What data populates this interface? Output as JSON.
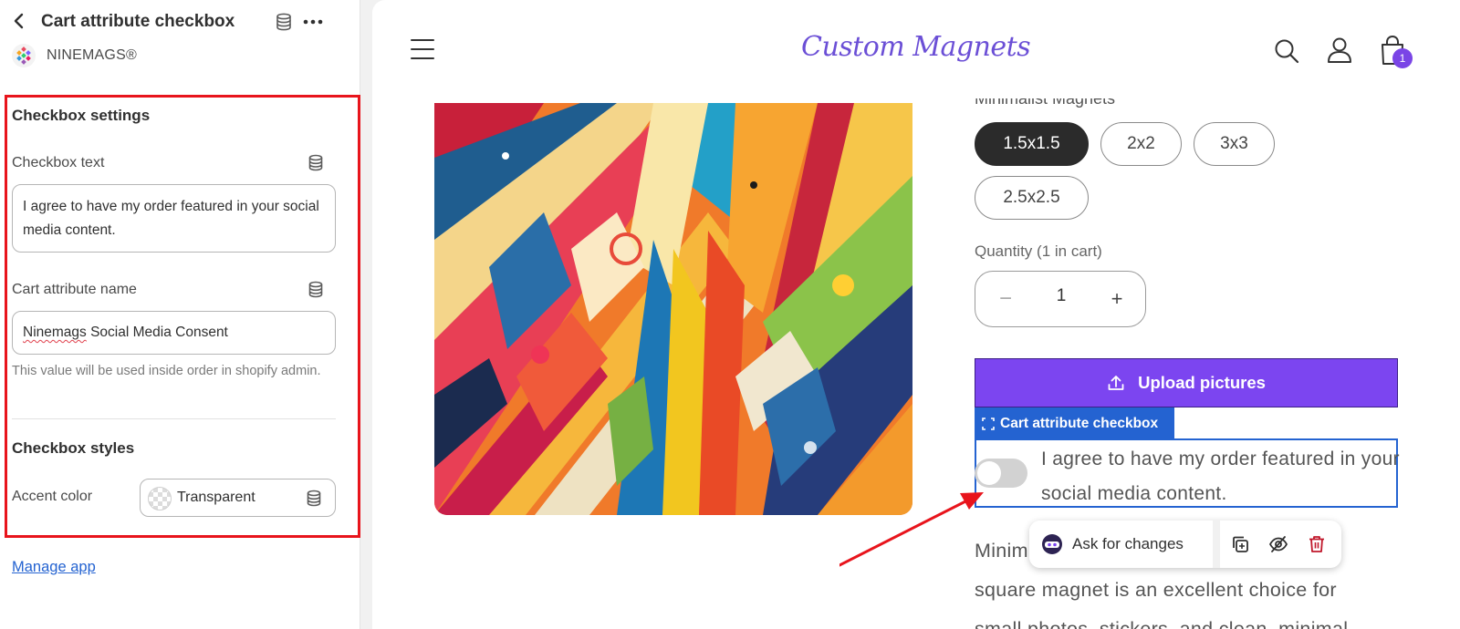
{
  "panel": {
    "title": "Cart attribute checkbox",
    "app_name": "NINEMAGS®",
    "section_checkbox_settings": "Checkbox settings",
    "checkbox_text_label": "Checkbox text",
    "checkbox_text_value": "I agree to have my order featured in your social media content.",
    "cart_attribute_label": "Cart attribute name",
    "cart_attribute_value_part1": "Ninemags",
    "cart_attribute_value_part2": " Social Media Consent",
    "help_text": "This value will be used inside order in shopify admin.",
    "section_checkbox_styles": "Checkbox styles",
    "accent_color_label": "Accent color",
    "accent_color_value": "Transparent",
    "manage_link": "Manage app"
  },
  "storefront": {
    "logo": "Custom Magnets",
    "cart_count": "1",
    "variant_label_cut": "Minimalist Magnets",
    "sizes": [
      "1.5x1.5",
      "2x2",
      "3x3",
      "2.5x2.5"
    ],
    "selected_size": "1.5x1.5",
    "quantity_label": "Quantity (1 in cart)",
    "quantity_value": "1",
    "minus": "−",
    "plus": "+",
    "upload_button": "Upload pictures",
    "block_tag": "Cart attribute checkbox",
    "checkbox_text": "I agree to have my order featured in your social media content.",
    "checkbox_checked": false,
    "ask_for_changes": "Ask for changes",
    "description_line1": "Minim",
    "description_line2": "square magnet is an excellent choice for",
    "description_line3": "small photos, stickers, and clean, minimal"
  },
  "colors": {
    "highlight_box": "#e8141c",
    "upload_button": "#7c45f0",
    "selection_blue": "#2463d1",
    "cart_badge": "#7a45e6",
    "logo": "#6b4fd6",
    "arrow": "#e8141c"
  },
  "icons": [
    "back-arrow-icon",
    "database-icon",
    "more-icon",
    "app-logo-icon",
    "menu-icon",
    "search-icon",
    "account-icon",
    "cart-icon",
    "upload-icon",
    "select-frame-icon",
    "ai-assistant-icon",
    "duplicate-icon",
    "hide-icon",
    "delete-icon"
  ]
}
